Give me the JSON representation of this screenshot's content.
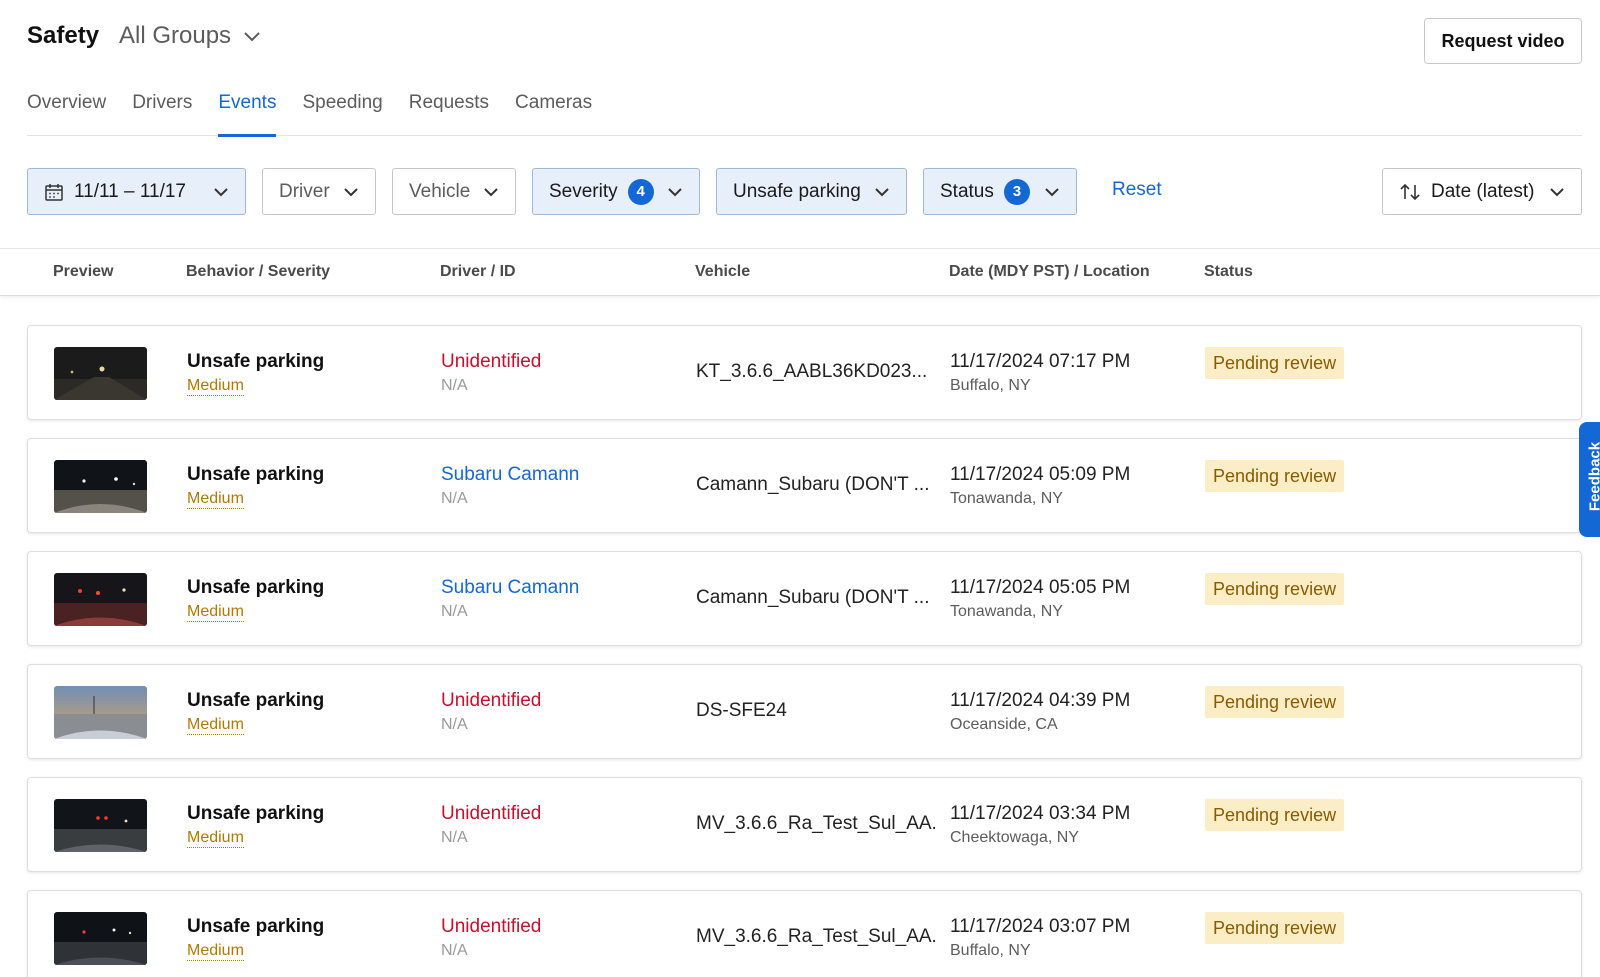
{
  "header": {
    "title": "Safety",
    "group_select": "All Groups",
    "request_video": "Request video"
  },
  "tabs": [
    {
      "label": "Overview"
    },
    {
      "label": "Drivers"
    },
    {
      "label": "Events",
      "active": true
    },
    {
      "label": "Speeding"
    },
    {
      "label": "Requests"
    },
    {
      "label": "Cameras"
    }
  ],
  "filters": {
    "date_range": "11/11 – 11/17",
    "driver": "Driver",
    "vehicle": "Vehicle",
    "severity": {
      "label": "Severity",
      "count": "4"
    },
    "behavior": "Unsafe parking",
    "status": {
      "label": "Status",
      "count": "3"
    },
    "reset": "Reset",
    "sort": "Date (latest)"
  },
  "columns": {
    "preview": "Preview",
    "behavior": "Behavior / Severity",
    "driver": "Driver / ID",
    "vehicle": "Vehicle",
    "date": "Date (MDY PST) / Location",
    "status": "Status"
  },
  "events": [
    {
      "behavior": "Unsafe parking",
      "severity": "Medium",
      "driver": "Unidentified",
      "driver_style": "red",
      "driver_id": "N/A",
      "vehicle": "KT_3.6.6_AABL36KD023...",
      "datetime": "11/17/2024 07:17 PM",
      "location": "Buffalo, NY",
      "status": "Pending review"
    },
    {
      "behavior": "Unsafe parking",
      "severity": "Medium",
      "driver": "Subaru Camann",
      "driver_style": "blue",
      "driver_id": "N/A",
      "vehicle": "Camann_Subaru (DON'T ...",
      "datetime": "11/17/2024 05:09 PM",
      "location": "Tonawanda, NY",
      "status": "Pending review"
    },
    {
      "behavior": "Unsafe parking",
      "severity": "Medium",
      "driver": "Subaru Camann",
      "driver_style": "blue",
      "driver_id": "N/A",
      "vehicle": "Camann_Subaru (DON'T ...",
      "datetime": "11/17/2024 05:05 PM",
      "location": "Tonawanda, NY",
      "status": "Pending review"
    },
    {
      "behavior": "Unsafe parking",
      "severity": "Medium",
      "driver": "Unidentified",
      "driver_style": "red",
      "driver_id": "N/A",
      "vehicle": "DS-SFE24",
      "datetime": "11/17/2024 04:39 PM",
      "location": "Oceanside, CA",
      "status": "Pending review"
    },
    {
      "behavior": "Unsafe parking",
      "severity": "Medium",
      "driver": "Unidentified",
      "driver_style": "red",
      "driver_id": "N/A",
      "vehicle": "MV_3.6.6_Ra_Test_Sul_AA...",
      "datetime": "11/17/2024 03:34 PM",
      "location": "Cheektowaga, NY",
      "status": "Pending review"
    },
    {
      "behavior": "Unsafe parking",
      "severity": "Medium",
      "driver": "Unidentified",
      "driver_style": "red",
      "driver_id": "N/A",
      "vehicle": "MV_3.6.6_Ra_Test_Sul_AA...",
      "datetime": "11/17/2024 03:07 PM",
      "location": "Buffalo, NY",
      "status": "Pending review"
    }
  ],
  "feedback": "Feedback",
  "colors": {
    "accent": "#1468d6",
    "danger": "#c8102e",
    "severity": "#b07a00",
    "pending_bg": "#fbedc5"
  }
}
